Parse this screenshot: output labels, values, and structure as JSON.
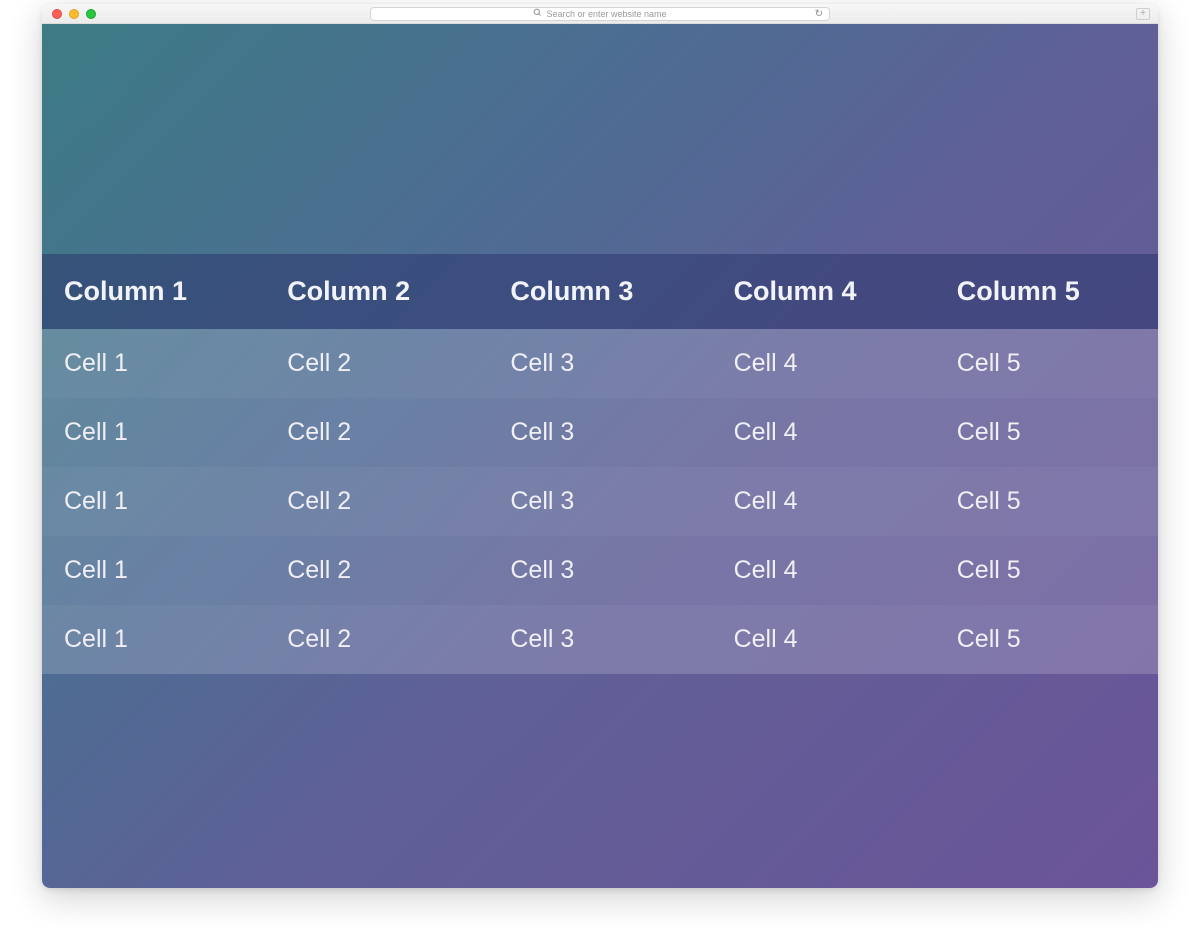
{
  "browser": {
    "search_placeholder": "Search or enter website name"
  },
  "table": {
    "headers": [
      "Column 1",
      "Column 2",
      "Column 3",
      "Column 4",
      "Column 5"
    ],
    "rows": [
      [
        "Cell 1",
        "Cell 2",
        "Cell 3",
        "Cell 4",
        "Cell 5"
      ],
      [
        "Cell 1",
        "Cell 2",
        "Cell 3",
        "Cell 4",
        "Cell 5"
      ],
      [
        "Cell 1",
        "Cell 2",
        "Cell 3",
        "Cell 4",
        "Cell 5"
      ],
      [
        "Cell 1",
        "Cell 2",
        "Cell 3",
        "Cell 4",
        "Cell 5"
      ],
      [
        "Cell 1",
        "Cell 2",
        "Cell 3",
        "Cell 4",
        "Cell 5"
      ]
    ]
  }
}
